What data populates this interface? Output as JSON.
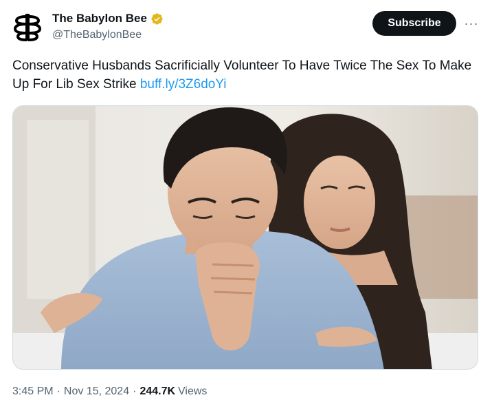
{
  "account": {
    "display_name": "The Babylon Bee",
    "handle": "@TheBabylonBee",
    "verified_badge": "gold-verified-badge-icon",
    "avatar": "babylon-bee-logo-icon"
  },
  "actions": {
    "subscribe_label": "Subscribe",
    "more_label": "···"
  },
  "tweet": {
    "text": "Conservative Husbands Sacrificially Volunteer To Have Twice The Sex To Make Up For Lib Sex Strike ",
    "link": "buff.ly/3Z6doYi"
  },
  "media": {
    "type": "photo"
  },
  "meta": {
    "time": "3:45 PM",
    "separator": "·",
    "date": "Nov 15, 2024",
    "views_count": "244.7K",
    "views_label": "Views"
  },
  "colors": {
    "link": "#1d9bf0",
    "text": "#0f1419",
    "secondary": "#536471",
    "badge": "#e2b719",
    "button": "#0f1419"
  }
}
